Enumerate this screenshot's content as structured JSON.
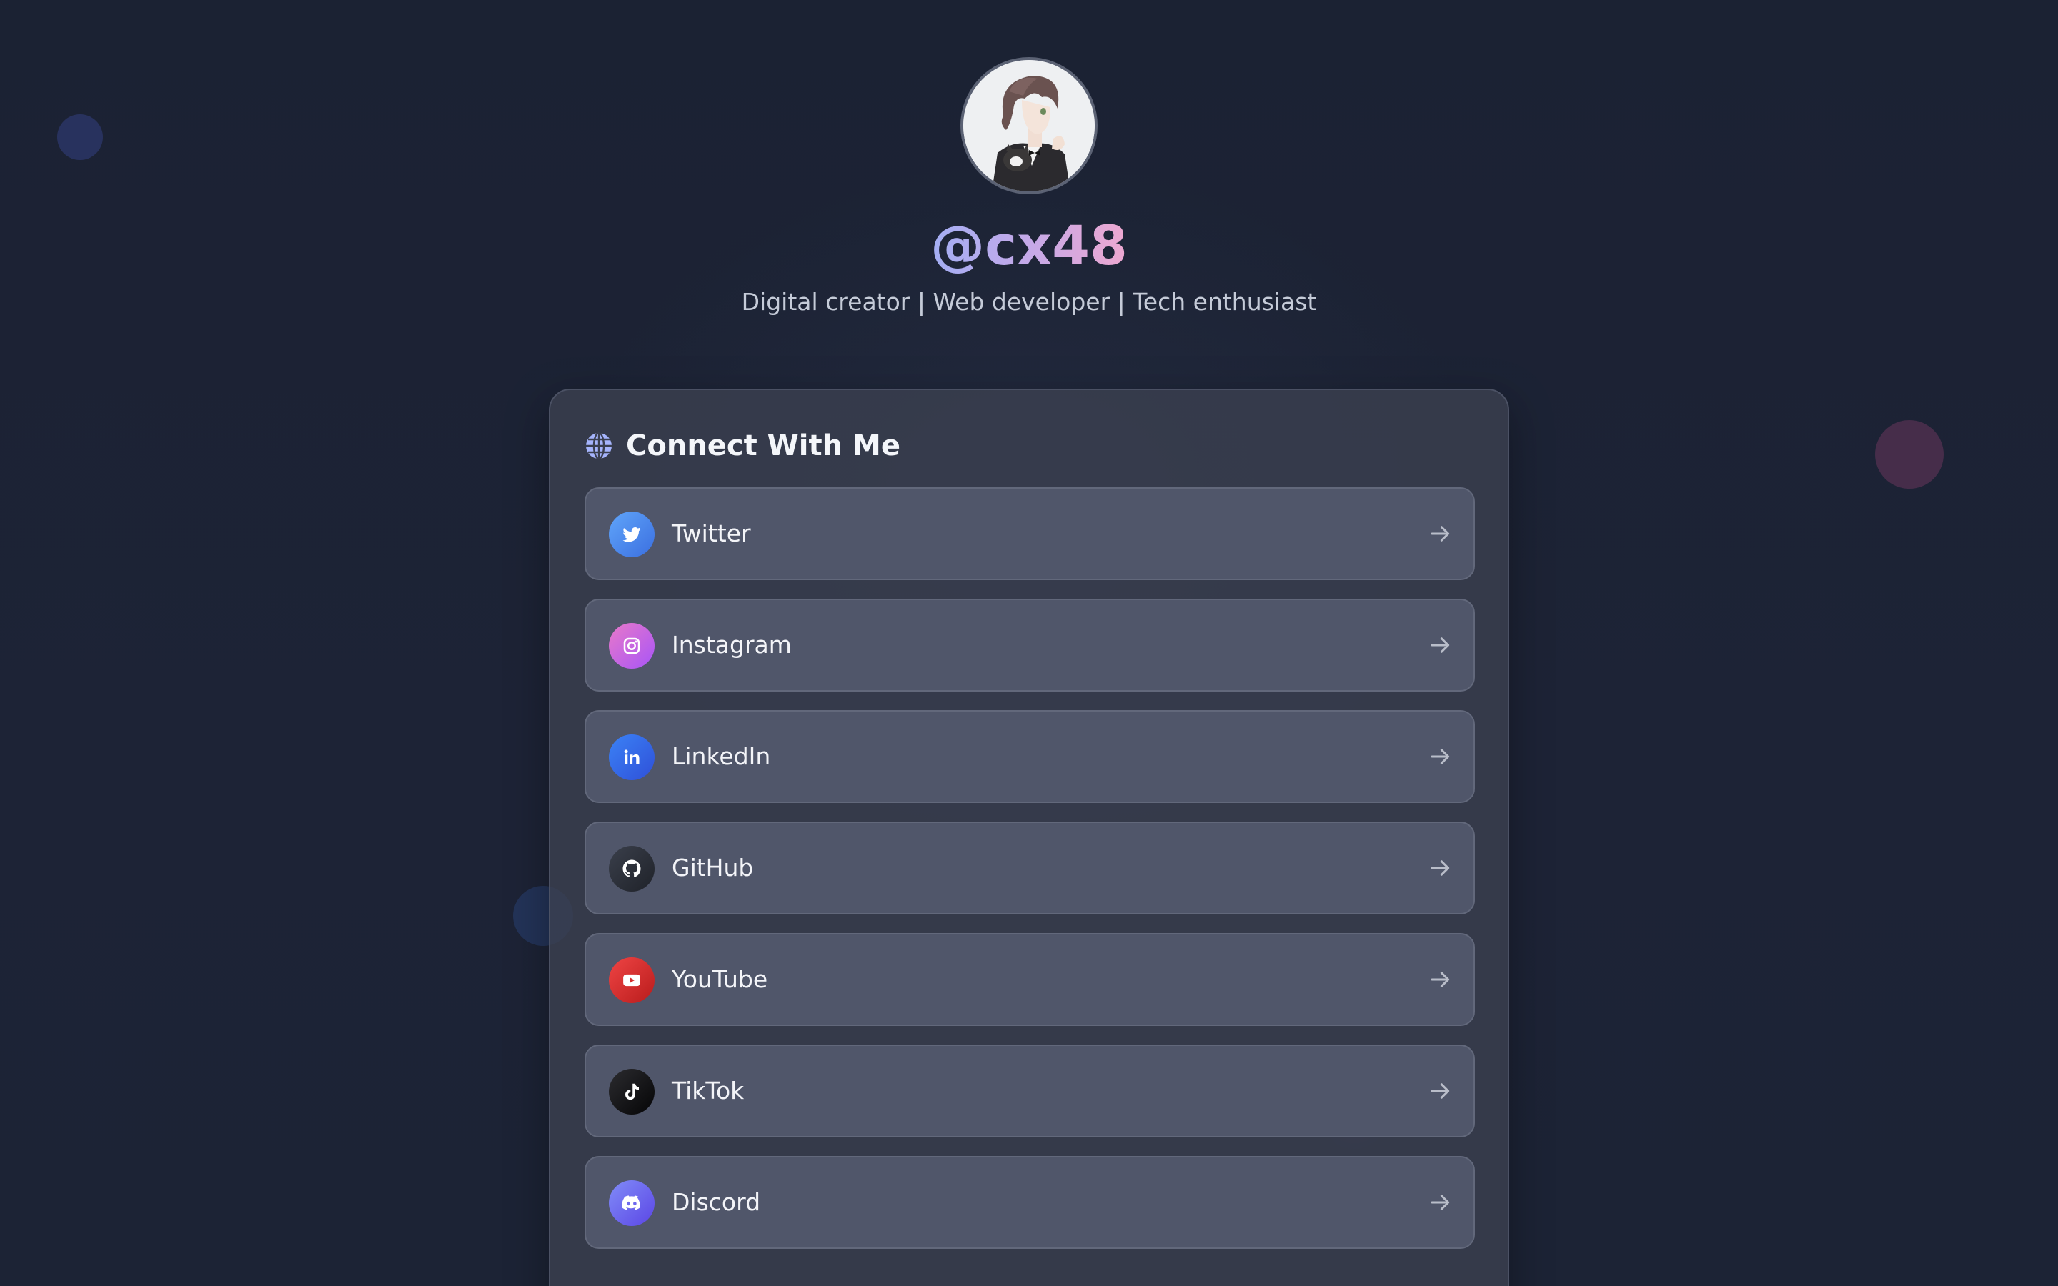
{
  "profile": {
    "handle": "@cx48",
    "bio": "Digital creator | Web developer | Tech enthusiast",
    "avatar_icon": "avatar-illustration"
  },
  "section": {
    "title": "Connect With Me",
    "icon": "globe-icon"
  },
  "links": [
    {
      "label": "Twitter",
      "icon": "twitter-icon",
      "color": "#3b82f6"
    },
    {
      "label": "Instagram",
      "icon": "instagram-icon",
      "color": "#c05ad8"
    },
    {
      "label": "LinkedIn",
      "icon": "linkedin-icon",
      "color": "#3563e9"
    },
    {
      "label": "GitHub",
      "icon": "github-icon",
      "color": "#24292f"
    },
    {
      "label": "YouTube",
      "icon": "youtube-icon",
      "color": "#dc2626"
    },
    {
      "label": "TikTok",
      "icon": "tiktok-icon",
      "color": "#111111"
    },
    {
      "label": "Discord",
      "icon": "discord-icon",
      "color": "#6366f1"
    }
  ],
  "theme": {
    "background": "#1c2233",
    "card": "#3a3f4f",
    "link_background": "#50566a",
    "handle_gradient": [
      "#a3aef4",
      "#eea8d0"
    ]
  }
}
